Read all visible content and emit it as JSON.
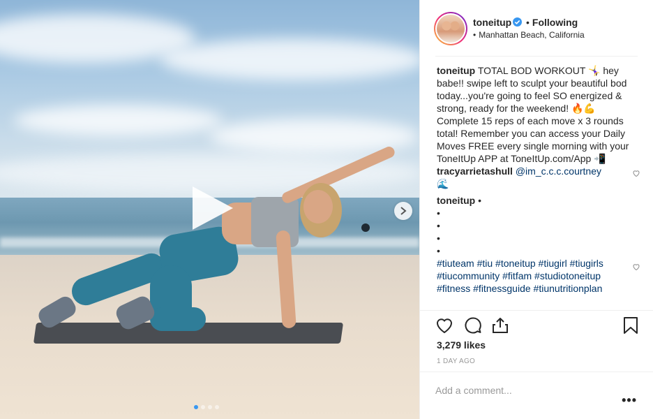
{
  "post": {
    "author": {
      "username": "toneitup",
      "verified": true,
      "follow_status": "Following",
      "location": "Manhattan Beach, California"
    },
    "caption": {
      "username": "toneitup",
      "text": "TOTAL BOD WORKOUT 🤸‍♀️ hey babe!! swipe left to sculpt your beautiful bod today...you're going to feel SO energized & strong, ready for the weekend! 🔥💪 Complete 15 reps of each move x 3 rounds total! Remember you can access your Daily Moves FREE every single morning with your ToneItUp APP at ToneItUp.com/App 📲"
    },
    "comments": [
      {
        "username": "tracyarrietashull",
        "mention": "@im_c.c.c.courtney",
        "text": "🌊"
      },
      {
        "username": "toneitup",
        "text": "•",
        "bullets": [
          "•",
          "•",
          "•",
          "•"
        ],
        "hashtags": "#tiuteam #tiu #toneitup #tiugirl #tiugirls #tiucommunity #fitfam #studiotoneitup #fitness #fitnessguide #tiunutritionplan"
      }
    ],
    "likes": "3,279 likes",
    "date": "1 DAY AGO",
    "add_comment_placeholder": "Add a comment...",
    "more_label": "•••"
  },
  "media": {
    "carousel_dots": 4,
    "active_dot": 1
  },
  "colors": {
    "link": "#003569",
    "verified": "#3897f0",
    "text": "#262626",
    "muted": "#999999"
  },
  "icons": {
    "like": "heart-icon",
    "comment": "comment-icon",
    "share": "share-icon",
    "save": "bookmark-icon",
    "play": "play-icon",
    "next": "chevron-right-icon"
  }
}
